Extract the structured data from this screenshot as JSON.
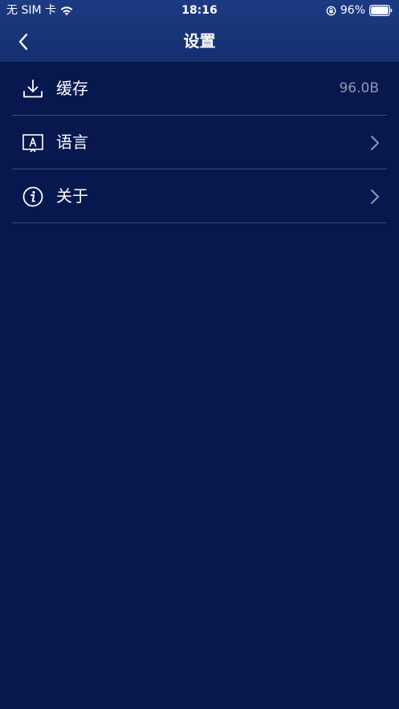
{
  "status_bar": {
    "carrier": "无 SIM 卡",
    "time": "18:16",
    "battery": "96%"
  },
  "nav": {
    "title": "设置"
  },
  "settings": {
    "items": [
      {
        "label": "缓存",
        "value": "96.0B",
        "icon": "download-icon"
      },
      {
        "label": "语言",
        "value": "",
        "icon": "language-icon"
      },
      {
        "label": "关于",
        "value": "",
        "icon": "info-icon"
      }
    ]
  },
  "colors": {
    "background": "#06184d",
    "header": "#1c3a82",
    "divider": "#3b4b78",
    "secondary_text": "#8d97b4"
  }
}
